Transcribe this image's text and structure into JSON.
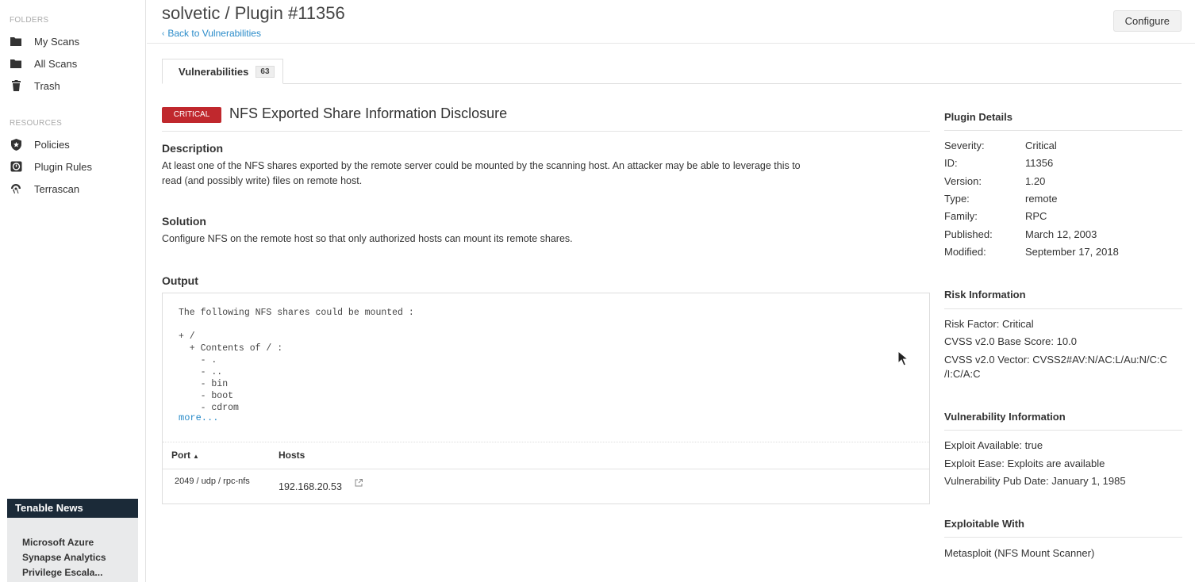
{
  "sidebar": {
    "folders_label": "FOLDERS",
    "folders": [
      {
        "label": "My Scans",
        "icon": "folder-icon"
      },
      {
        "label": "All Scans",
        "icon": "folder-icon"
      },
      {
        "label": "Trash",
        "icon": "trash-icon"
      }
    ],
    "resources_label": "RESOURCES",
    "resources": [
      {
        "label": "Policies",
        "icon": "shield-icon"
      },
      {
        "label": "Plugin Rules",
        "icon": "plugin-rules-icon"
      },
      {
        "label": "Terrascan",
        "icon": "terrascan-icon"
      }
    ],
    "news": {
      "title": "Tenable News",
      "lines": [
        "Microsoft Azure",
        "Synapse Analytics",
        "Privilege Escala..."
      ]
    }
  },
  "header": {
    "title": "solvetic / Plugin #11356",
    "back_label": "Back to Vulnerabilities",
    "configure_label": "Configure"
  },
  "tabs": [
    {
      "label": "Vulnerabilities",
      "count": "63"
    }
  ],
  "vuln": {
    "severity": "Critical",
    "title": "NFS Exported Share Information Disclosure",
    "description_heading": "Description",
    "description_line1": "At least one of the NFS shares exported by the remote server could be mounted by the scanning host. An attacker may be able to leverage this to",
    "description_line2": "read (and possibly write) files on remote host.",
    "solution_heading": "Solution",
    "solution": "Configure NFS on the remote host so that only authorized hosts can mount its remote shares.",
    "output_heading": "Output",
    "output_text": "The following NFS shares could be mounted :\n\n+ /\n  + Contents of / :\n    - .\n    - ..\n    - bin\n    - boot\n    - cdrom",
    "more_label": "more...",
    "table": {
      "col_port": "Port",
      "col_hosts": "Hosts",
      "sort_indicator": "▲",
      "rows": [
        {
          "port": "2049 / udp / rpc-nfs",
          "host": "192.168.20.53"
        }
      ]
    }
  },
  "plugin_details": {
    "heading": "Plugin Details",
    "rows": [
      {
        "key": "Severity:",
        "value": "Critical"
      },
      {
        "key": "ID:",
        "value": "11356"
      },
      {
        "key": "Version:",
        "value": "1.20"
      },
      {
        "key": "Type:",
        "value": "remote"
      },
      {
        "key": "Family:",
        "value": "RPC"
      },
      {
        "key": "Published:",
        "value": "March 12, 2003"
      },
      {
        "key": "Modified:",
        "value": "September 17, 2018"
      }
    ]
  },
  "risk_info": {
    "heading": "Risk Information",
    "risk_factor": "Risk Factor: Critical",
    "cvss_score": "CVSS v2.0 Base Score: 10.0",
    "cvss_vector_line1": "CVSS v2.0 Vector: CVSS2#AV:N/AC:L/Au:N/C:C",
    "cvss_vector_line2": "/I:C/A:C"
  },
  "vuln_info": {
    "heading": "Vulnerability Information",
    "exploit_available": "Exploit Available: true",
    "exploit_ease": "Exploit Ease: Exploits are available",
    "pub_date": "Vulnerability Pub Date: January 1, 1985"
  },
  "exploitable_with": {
    "heading": "Exploitable With",
    "value": "Metasploit (NFS Mount Scanner)"
  },
  "colors": {
    "critical": "#c0282d",
    "link": "#2a8bc9",
    "news_header": "#1b2a38"
  }
}
